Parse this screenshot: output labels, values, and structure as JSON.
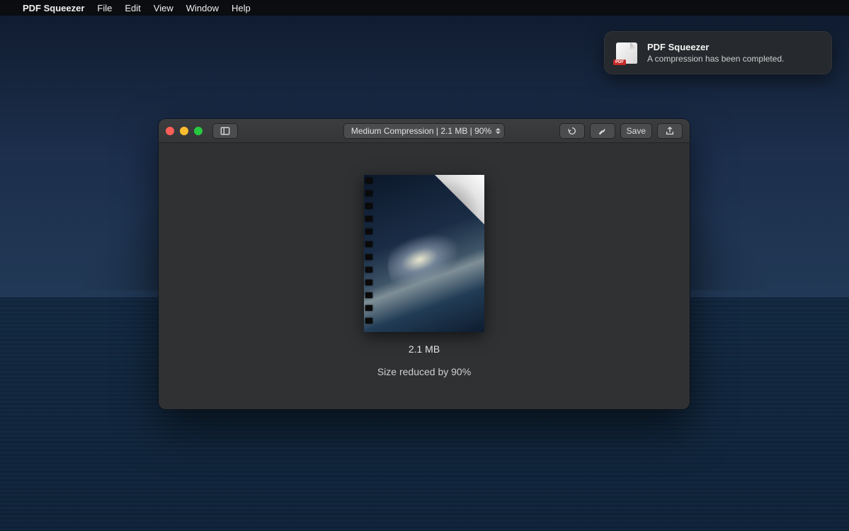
{
  "menubar": {
    "app_name": "PDF Squeezer",
    "items": [
      "File",
      "Edit",
      "View",
      "Window",
      "Help"
    ]
  },
  "notification": {
    "title": "PDF Squeezer",
    "message": "A compression has been completed.",
    "badge": "PDF"
  },
  "toolbar": {
    "compression_label": "Medium Compression | 2.1 MB | 90%",
    "save_label": "Save"
  },
  "document": {
    "size_line": "2.1 MB",
    "reduced_line": "Size reduced by 90%"
  }
}
